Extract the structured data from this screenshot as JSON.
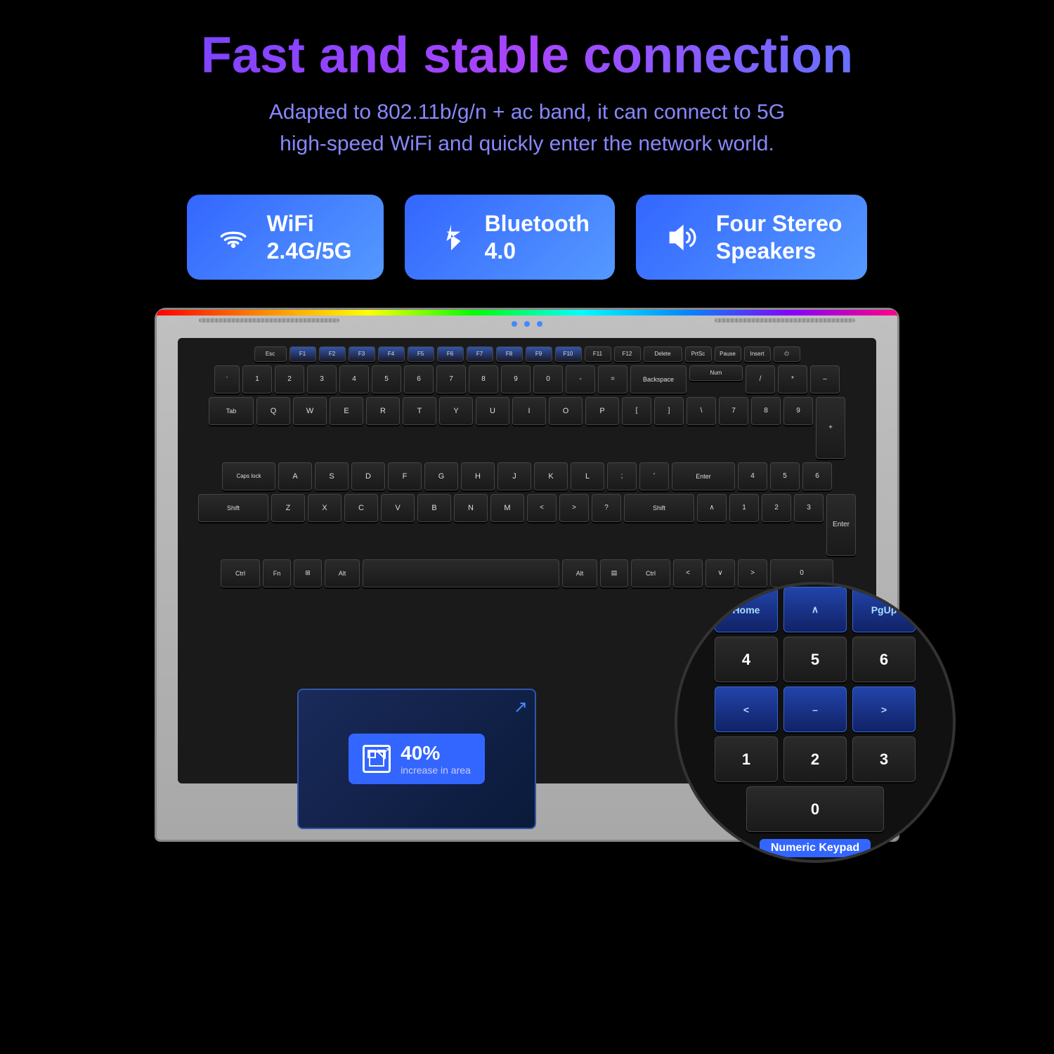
{
  "page": {
    "background": "#000000"
  },
  "header": {
    "title": "Fast and stable connection",
    "subtitle_line1": "Adapted to 802.11b/g/n + ac band, it can connect to 5G",
    "subtitle_line2": "high-speed WiFi and quickly enter the network world."
  },
  "badges": [
    {
      "id": "wifi",
      "icon": "wifi-icon",
      "label_line1": "WiFi",
      "label_line2": "2.4G/5G"
    },
    {
      "id": "bluetooth",
      "icon": "bluetooth-icon",
      "label_line1": "Bluetooth",
      "label_line2": "4.0"
    },
    {
      "id": "speakers",
      "icon": "speaker-icon",
      "label_line1": "Four Stereo",
      "label_line2": "Speakers"
    }
  ],
  "touchpad": {
    "percent": "40%",
    "description": "increase in area"
  },
  "numpad": {
    "label": "Numeric Keypad",
    "rows": [
      [
        "Home",
        "∧",
        "PgUp"
      ],
      [
        "4",
        "5",
        "6"
      ],
      [
        "<",
        "–",
        ">"
      ],
      [
        "1",
        "2",
        "3"
      ],
      [
        "0"
      ]
    ]
  }
}
